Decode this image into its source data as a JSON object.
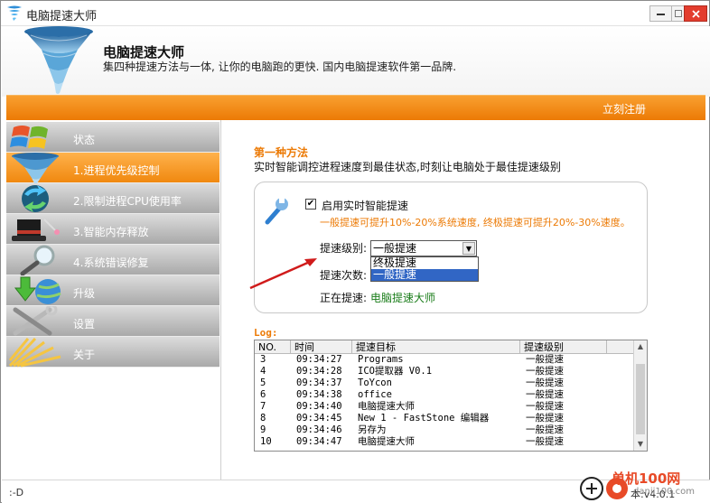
{
  "window": {
    "title": "电脑提速大师"
  },
  "header": {
    "app_name": "电脑提速大师",
    "slogan": "集四种提速方法与一体, 让你的电脑跑的更快. 国内电脑提速软件第一品牌."
  },
  "topbar": {
    "register_label": "立刻注册"
  },
  "sidebar": {
    "items": [
      {
        "label": "状态",
        "icon": "windows-logo-icon",
        "active": false
      },
      {
        "label": "1.进程优先级控制",
        "icon": "tornado-icon",
        "active": true
      },
      {
        "label": "2.限制进程CPU使用率",
        "icon": "recycle-arrows-icon",
        "active": false
      },
      {
        "label": "3.智能内存释放",
        "icon": "magic-hat-icon",
        "active": false
      },
      {
        "label": "4.系统错误修复",
        "icon": "magnifier-icon",
        "active": false
      },
      {
        "label": "升级",
        "icon": "download-globe-icon",
        "active": false
      },
      {
        "label": "设置",
        "icon": "tools-icon",
        "active": false
      },
      {
        "label": "关于",
        "icon": "light-burst-icon",
        "active": false
      }
    ]
  },
  "main": {
    "method_title": "第一种方法",
    "method_desc": "实时智能调控进程速度到最佳状态,时刻让电脑处于最佳提速级别",
    "enable_label": "启用实时智能提速",
    "enable_checked": "✔",
    "hint": "一般提速可提升10%-20%系统速度, 终极提速可提升20%-30%速度。",
    "level_label": "提速级别:",
    "level_value": "一般提速",
    "level_options": [
      "终极提速",
      "一般提速"
    ],
    "times_label": "提速次数:",
    "now_label": "正在提速:",
    "now_value": "电脑提速大师"
  },
  "log": {
    "title": "Log:",
    "columns": [
      "NO.",
      "时间",
      "提速目标",
      "提速级别"
    ],
    "rows": [
      [
        "3",
        "09:34:27",
        "Programs",
        "一般提速"
      ],
      [
        "4",
        "09:34:28",
        "ICO提取器 V0.1",
        "一般提速"
      ],
      [
        "5",
        "09:34:37",
        "ToYcon",
        "一般提速"
      ],
      [
        "6",
        "09:34:38",
        "office",
        "一般提速"
      ],
      [
        "7",
        "09:34:40",
        "电脑提速大师",
        "一般提速"
      ],
      [
        "8",
        "09:34:45",
        "New 1 - FastStone 编辑器",
        "一般提速"
      ],
      [
        "9",
        "09:34:46",
        "另存为",
        "一般提速"
      ],
      [
        "10",
        "09:34:47",
        "电脑提速大师",
        "一般提速"
      ]
    ]
  },
  "status": {
    "left": ":-D",
    "version": "本:v4.0.1"
  },
  "watermark": {
    "site": "单机100网",
    "url": "danji100.com"
  },
  "colors": {
    "accent": "#ec7a05",
    "nav_inactive": "#a9a9a9",
    "active_green": "#1a7d1a",
    "select_blue": "#3166c5"
  }
}
